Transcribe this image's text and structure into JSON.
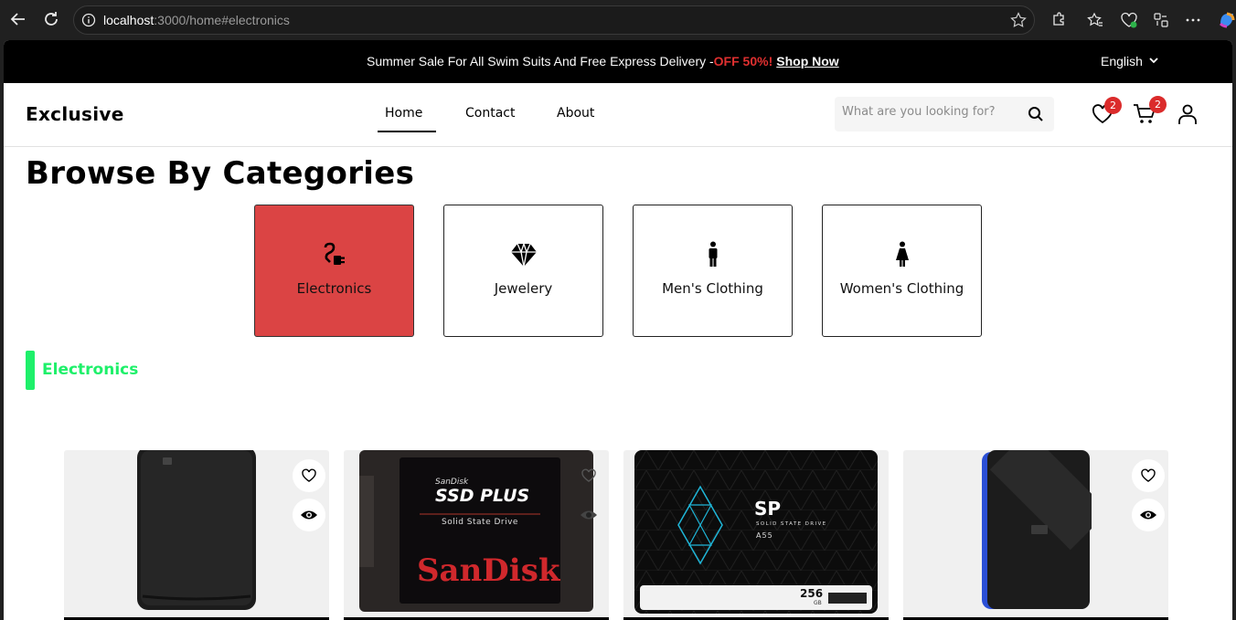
{
  "browser": {
    "url_host": "localhost",
    "url_rest": ":3000/home#electronics"
  },
  "topbar": {
    "promo_text": "Summer Sale For All Swim Suits And Free Express Delivery -",
    "promo_sale": "OFF 50%!",
    "promo_link": "Shop Now",
    "language": "English"
  },
  "header": {
    "logo": "Exclusive",
    "nav": {
      "home": "Home",
      "contact": "Contact",
      "about": "About"
    },
    "search_placeholder": "What are you looking for?",
    "wishlist_count": "2",
    "cart_count": "2"
  },
  "main": {
    "title": "Browse By Categories",
    "categories": [
      {
        "label": "Electronics",
        "icon": "plug-icon",
        "active": true
      },
      {
        "label": "Jewelery",
        "icon": "diamond-icon",
        "active": false
      },
      {
        "label": "Men's Clothing",
        "icon": "man-icon",
        "active": false
      },
      {
        "label": "Women's Clothing",
        "icon": "woman-icon",
        "active": false
      }
    ],
    "section_label": "Electronics",
    "products": [
      {
        "image": "wd-portable-hard-drive-black",
        "actions": [
          "heart-icon",
          "eye-icon"
        ]
      },
      {
        "image": "sandisk-ssd-plus",
        "brand_line1": "SanDisk",
        "brand_line2": "SSD PLUS",
        "brand_line3": "Solid State Drive",
        "brand_logo": "SanDisk"
      },
      {
        "image": "silicon-power-a55-ssd",
        "brand_logo": "SP",
        "brand_sub": "SOLID STATE DRIVE",
        "model": "A55",
        "capacity": "256",
        "unit": "GB"
      },
      {
        "image": "wd-gaming-drive-blue",
        "actions": [
          "heart-icon",
          "eye-icon"
        ]
      }
    ]
  },
  "colors": {
    "accent_red": "#db4444",
    "badge_red": "#db2b2b",
    "section_green": "#1ef06a"
  }
}
